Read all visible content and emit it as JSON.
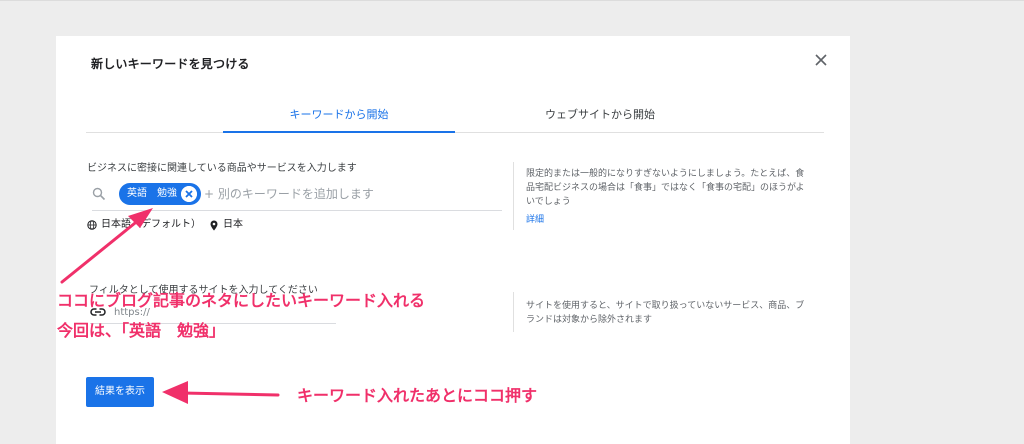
{
  "dialog": {
    "title": "新しいキーワードを見つける",
    "tabs": [
      {
        "label": "キーワードから開始",
        "active": true
      },
      {
        "label": "ウェブサイトから開始",
        "active": false
      }
    ],
    "keyword_section": {
      "label": "ビジネスに密接に関連している商品やサービスを入力します",
      "chip": "英語　勉強",
      "add_placeholder": "+ 別のキーワードを追加します",
      "language": "日本語（デフォルト）",
      "location": "日本",
      "help_text": "限定的または一般的になりすぎないようにしましょう。たとえば、食品宅配ビジネスの場合は「食事」ではなく「食事の宅配」のほうがよいでしょう",
      "help_link": "詳細"
    },
    "website_section": {
      "label": "フィルタとして使用するサイトを入力してください",
      "placeholder": "https://",
      "help_text": "サイトを使用すると、サイトで取り扱っていないサービス、商品、ブランドは対象から除外されます"
    },
    "results_button": "結果を表示"
  },
  "annotations": {
    "line1": "ココにブログ記事のネタにしたいキーワード入れる",
    "line2": "今回は、「英語　勉強」",
    "line3": "キーワード入れたあとにココ押す",
    "color": "#f0306a"
  },
  "colors": {
    "accent": "#1a73e8",
    "background": "#ededed",
    "annotation": "#f0306a"
  },
  "icons": [
    "close-icon",
    "search-icon",
    "globe-icon",
    "location-pin-icon",
    "link-icon",
    "chip-remove-icon",
    "arrow-icon"
  ]
}
